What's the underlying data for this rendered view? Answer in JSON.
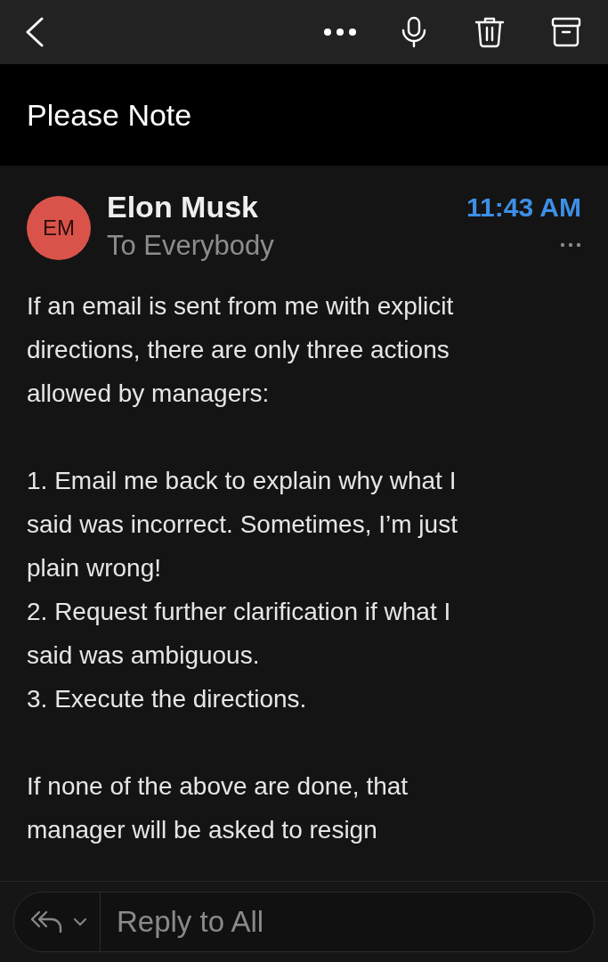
{
  "subject": "Please Note",
  "message": {
    "avatar_initials": "EM",
    "sender": "Elon Musk",
    "recipients": "To Everybody",
    "time": "11:43 AM"
  },
  "body": [
    [
      "If an email is sent from me with explicit",
      "directions, there are only three actions",
      "allowed by managers:"
    ],
    [
      "1. Email me back to explain why what I",
      "said was incorrect. Sometimes, I’m just",
      "plain wrong!",
      "2. Request further clarification if what I",
      "said was ambiguous.",
      "3. Execute the directions."
    ],
    [
      "If none of the above are done, that",
      "manager will be asked to resign"
    ]
  ],
  "reply": {
    "placeholder": "Reply to All"
  }
}
